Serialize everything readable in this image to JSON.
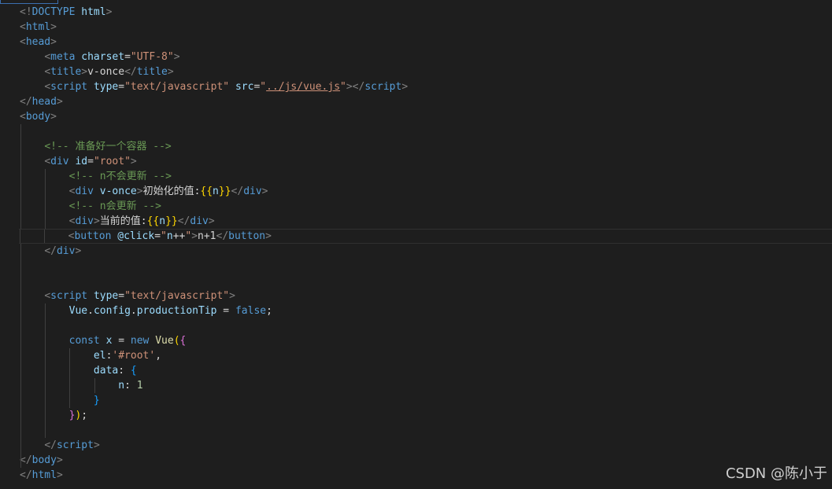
{
  "lines": [
    [
      [
        "t",
        "<!"
      ],
      [
        "n",
        "DOCTYPE"
      ],
      [
        "x",
        " "
      ],
      [
        "a",
        "html"
      ],
      [
        "t",
        ">"
      ]
    ],
    [
      [
        "t",
        "<"
      ],
      [
        "n",
        "html"
      ],
      [
        "t",
        ">"
      ]
    ],
    [
      [
        "t",
        "<"
      ],
      [
        "n",
        "head"
      ],
      [
        "t",
        ">"
      ]
    ],
    [
      [
        "x",
        "    "
      ],
      [
        "t",
        "<"
      ],
      [
        "n",
        "meta"
      ],
      [
        "x",
        " "
      ],
      [
        "a",
        "charset"
      ],
      [
        "x",
        "="
      ],
      [
        "s",
        "\"UTF-8\""
      ],
      [
        "t",
        ">"
      ]
    ],
    [
      [
        "x",
        "    "
      ],
      [
        "t",
        "<"
      ],
      [
        "n",
        "title"
      ],
      [
        "t",
        ">"
      ],
      [
        "x",
        "v-once"
      ],
      [
        "t",
        "</"
      ],
      [
        "n",
        "title"
      ],
      [
        "t",
        ">"
      ]
    ],
    [
      [
        "x",
        "    "
      ],
      [
        "t",
        "<"
      ],
      [
        "n",
        "script"
      ],
      [
        "x",
        " "
      ],
      [
        "a",
        "type"
      ],
      [
        "x",
        "="
      ],
      [
        "s",
        "\"text/javascript\""
      ],
      [
        "x",
        " "
      ],
      [
        "a",
        "src"
      ],
      [
        "x",
        "="
      ],
      [
        "s",
        "\""
      ],
      [
        "su",
        "../js/vue.js"
      ],
      [
        "s",
        "\""
      ],
      [
        "t",
        "></"
      ],
      [
        "n",
        "script"
      ],
      [
        "t",
        ">"
      ]
    ],
    [
      [
        "t",
        "</"
      ],
      [
        "n",
        "head"
      ],
      [
        "t",
        ">"
      ]
    ],
    [
      [
        "t",
        "<"
      ],
      [
        "n",
        "body"
      ],
      [
        "t",
        ">"
      ]
    ],
    [],
    [
      [
        "x",
        "    "
      ],
      [
        "c",
        "<!-- 准备好一个容器 -->"
      ]
    ],
    [
      [
        "x",
        "    "
      ],
      [
        "t",
        "<"
      ],
      [
        "n",
        "div"
      ],
      [
        "x",
        " "
      ],
      [
        "a",
        "id"
      ],
      [
        "x",
        "="
      ],
      [
        "s",
        "\"root\""
      ],
      [
        "t",
        ">"
      ]
    ],
    [
      [
        "x",
        "        "
      ],
      [
        "c",
        "<!-- n不会更新 -->"
      ]
    ],
    [
      [
        "x",
        "        "
      ],
      [
        "t",
        "<"
      ],
      [
        "n",
        "div"
      ],
      [
        "x",
        " "
      ],
      [
        "a",
        "v-once"
      ],
      [
        "t",
        ">"
      ],
      [
        "x",
        "初始化的值:"
      ],
      [
        "y",
        "{{"
      ],
      [
        "a",
        "n"
      ],
      [
        "y",
        "}}"
      ],
      [
        "t",
        "</"
      ],
      [
        "n",
        "div"
      ],
      [
        "t",
        ">"
      ]
    ],
    [
      [
        "x",
        "        "
      ],
      [
        "c",
        "<!-- n会更新 -->"
      ]
    ],
    [
      [
        "x",
        "        "
      ],
      [
        "t",
        "<"
      ],
      [
        "n",
        "div"
      ],
      [
        "t",
        ">"
      ],
      [
        "x",
        "当前的值:"
      ],
      [
        "y",
        "{{"
      ],
      [
        "a",
        "n"
      ],
      [
        "y",
        "}}"
      ],
      [
        "t",
        "</"
      ],
      [
        "n",
        "div"
      ],
      [
        "t",
        ">"
      ]
    ],
    [
      [
        "x",
        "        "
      ],
      [
        "t",
        "<"
      ],
      [
        "n",
        "button"
      ],
      [
        "x",
        " "
      ],
      [
        "a",
        "@click"
      ],
      [
        "x",
        "="
      ],
      [
        "s",
        "\""
      ],
      [
        "a",
        "n"
      ],
      [
        "x",
        "++"
      ],
      [
        "s",
        "\""
      ],
      [
        "t",
        ">"
      ],
      [
        "x",
        "n+1"
      ],
      [
        "t",
        "</"
      ],
      [
        "n",
        "button"
      ],
      [
        "t",
        ">"
      ]
    ],
    [
      [
        "x",
        "    "
      ],
      [
        "t",
        "</"
      ],
      [
        "n",
        "div"
      ],
      [
        "t",
        ">"
      ]
    ],
    [],
    [],
    [
      [
        "x",
        "    "
      ],
      [
        "t",
        "<"
      ],
      [
        "n",
        "script"
      ],
      [
        "x",
        " "
      ],
      [
        "a",
        "type"
      ],
      [
        "x",
        "="
      ],
      [
        "s",
        "\"text/javascript\""
      ],
      [
        "t",
        ">"
      ]
    ],
    [
      [
        "x",
        "        "
      ],
      [
        "a",
        "Vue"
      ],
      [
        "x",
        "."
      ],
      [
        "a",
        "config"
      ],
      [
        "x",
        "."
      ],
      [
        "a",
        "productionTip"
      ],
      [
        "x",
        " = "
      ],
      [
        "n",
        "false"
      ],
      [
        "x",
        ";"
      ]
    ],
    [],
    [
      [
        "x",
        "        "
      ],
      [
        "n",
        "const"
      ],
      [
        "x",
        " "
      ],
      [
        "a",
        "x"
      ],
      [
        "x",
        " = "
      ],
      [
        "n",
        "new"
      ],
      [
        "x",
        " "
      ],
      [
        "f",
        "Vue"
      ],
      [
        "y",
        "("
      ],
      [
        "p",
        "{"
      ]
    ],
    [
      [
        "x",
        "            "
      ],
      [
        "a",
        "el"
      ],
      [
        "x",
        ":"
      ],
      [
        "s",
        "'#root'"
      ],
      [
        "x",
        ","
      ]
    ],
    [
      [
        "x",
        "            "
      ],
      [
        "a",
        "data"
      ],
      [
        "x",
        ": "
      ],
      [
        "b",
        "{"
      ]
    ],
    [
      [
        "x",
        "                "
      ],
      [
        "a",
        "n"
      ],
      [
        "x",
        ": "
      ],
      [
        "num",
        "1"
      ]
    ],
    [
      [
        "x",
        "            "
      ],
      [
        "b",
        "}"
      ]
    ],
    [
      [
        "x",
        "        "
      ],
      [
        "p",
        "}"
      ],
      [
        "y",
        ")"
      ],
      [
        "x",
        ";"
      ]
    ],
    [],
    [
      [
        "x",
        "    "
      ],
      [
        "t",
        "</"
      ],
      [
        "n",
        "script"
      ],
      [
        "t",
        ">"
      ]
    ],
    [
      [
        "t",
        "</"
      ],
      [
        "n",
        "body"
      ],
      [
        "t",
        ">"
      ]
    ],
    [
      [
        "t",
        "</"
      ],
      [
        "n",
        "html"
      ],
      [
        "t",
        ">"
      ]
    ]
  ],
  "watermark": "CSDN @陈小于",
  "colors": {
    "background": "#1e1e1e",
    "tag_bracket": "#808080",
    "tag_name": "#569cd6",
    "attribute": "#9cdcfe",
    "string": "#ce9178",
    "comment": "#6a9955",
    "text": "#d4d4d4",
    "brace": "#ffd700",
    "function": "#dcdcaa",
    "number": "#b5cea8",
    "bracket_pair_2": "#da70d6",
    "bracket_pair_3": "#179fff"
  }
}
